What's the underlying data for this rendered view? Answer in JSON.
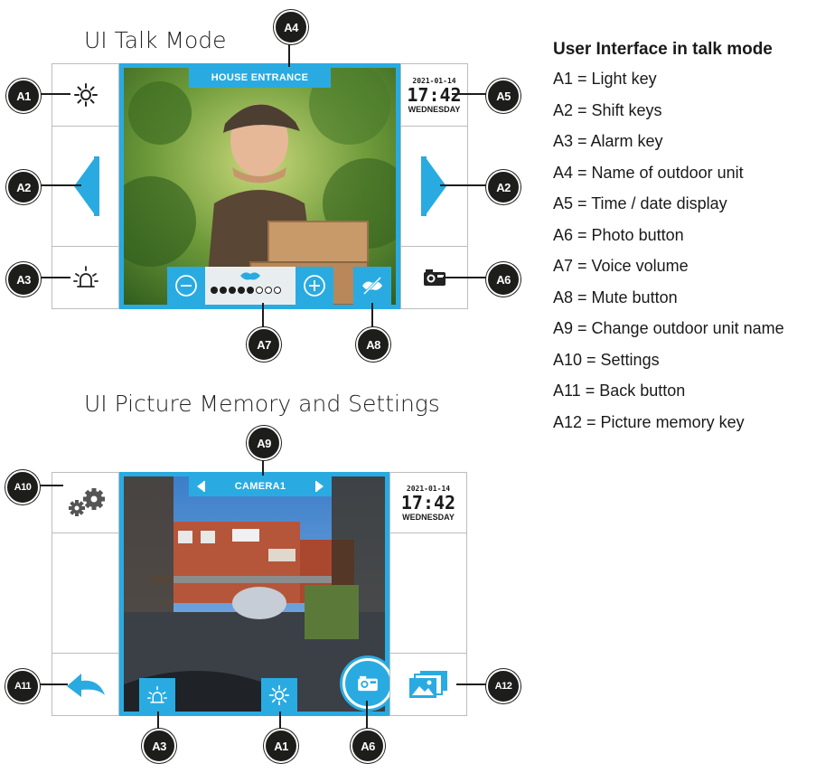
{
  "talk_mode": {
    "title": "UI Talk Mode",
    "outdoor_unit_name": "HOUSE ENTRANCE",
    "clock": {
      "date": "2021-01-14",
      "time": "17:42",
      "day": "WEDNESDAY"
    },
    "volume": {
      "level": 5,
      "max": 8
    }
  },
  "memory_mode": {
    "title": "UI Picture Memory and Settings",
    "camera_name": "CAMERA1",
    "clock": {
      "date": "2021-01-14",
      "time": "17:42",
      "day": "WEDNESDAY"
    }
  },
  "badges": {
    "a1": "A1",
    "a2": "A2",
    "a3": "A3",
    "a4": "A4",
    "a5": "A5",
    "a6": "A6",
    "a7": "A7",
    "a8": "A8",
    "a9": "A9",
    "a10": "A10",
    "a11": "A11",
    "a12": "A12"
  },
  "legend": {
    "title": "User Interface  in talk mode",
    "items": [
      "A1 = Light key",
      "A2 = Shift keys",
      "A3 = Alarm key",
      "A4 = Name of outdoor unit",
      "A5 = Time / date display",
      "A6 = Photo button",
      "A7 = Voice volume",
      "A8 = Mute button",
      "A9 = Change outdoor unit name",
      "A10 = Settings",
      "A11 = Back button",
      "A12 = Picture memory key"
    ]
  },
  "colors": {
    "accent": "#29abe2",
    "badge": "#1d1d1b",
    "border": "#bdbdbd"
  }
}
